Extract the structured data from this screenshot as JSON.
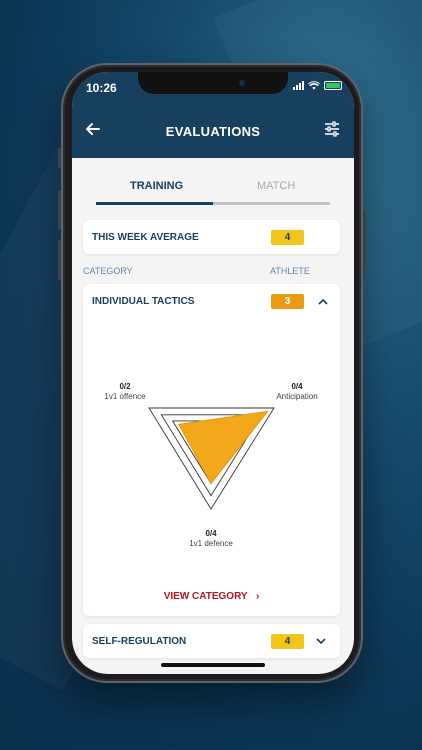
{
  "status_bar": {
    "time": "10:26"
  },
  "header": {
    "title": "EVALUATIONS",
    "back_icon": "back-arrow-icon",
    "filter_icon": "sliders-icon"
  },
  "tabs": [
    {
      "label": "TRAINING",
      "active": true
    },
    {
      "label": "MATCH",
      "active": false
    }
  ],
  "week_average": {
    "label": "THIS WEEK AVERAGE",
    "value": "4",
    "color": "#f2c518"
  },
  "columns": {
    "category": "CATEGORY",
    "athlete": "ATHLETE"
  },
  "categories": [
    {
      "name": "INDIVIDUAL TACTICS",
      "score": "3",
      "color": "#ec9a12",
      "expanded": true,
      "radar": [
        {
          "label": "1v1 offence",
          "score": "0/2",
          "value": 2
        },
        {
          "label": "Anticipation",
          "score": "0/4",
          "value": 4
        },
        {
          "label": "1v1 defence",
          "score": "0/4",
          "value": 4
        }
      ],
      "view_label": "VIEW CATEGORY"
    },
    {
      "name": "SELF-REGULATION",
      "score": "4",
      "color": "#f2c518",
      "expanded": false
    }
  ],
  "colors": {
    "header": "#173f5e",
    "accent_red": "#b3171e",
    "fill_orange": "#f3a81b"
  }
}
